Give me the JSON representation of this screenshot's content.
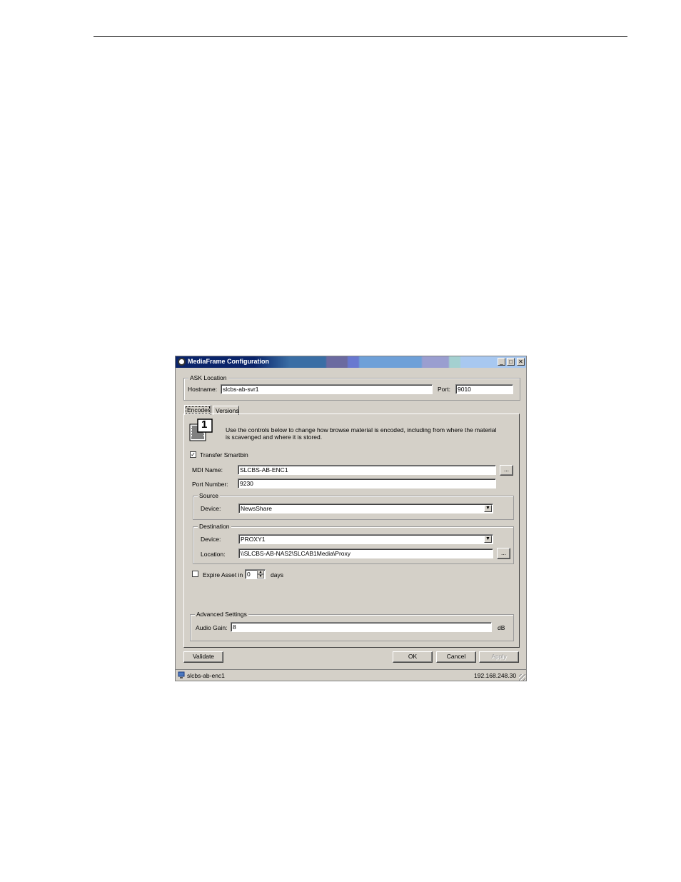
{
  "window": {
    "title": "MediaFrame Configuration",
    "minimize_glyph": "_",
    "maximize_glyph": "□",
    "close_glyph": "✕"
  },
  "ask_location": {
    "legend": "ASK Location",
    "hostname_label": "Hostname:",
    "hostname_value": "slcbs-ab-svr1",
    "port_label": "Port:",
    "port_value": "9010"
  },
  "tabs": [
    {
      "label": "Encoder",
      "selected": true
    },
    {
      "label": "Versions",
      "selected": false
    }
  ],
  "encoder": {
    "icon_digit": "1",
    "description": "Use the controls below to change how browse material is encoded, including from where the material is scavenged and where it is stored.",
    "transfer_smartbin_label": "Transfer Smartbin",
    "transfer_smartbin_checked": true,
    "check_glyph": "✓",
    "mdi_name_label": "MDI Name:",
    "mdi_name_value": "SLCBS-AB-ENC1",
    "browse_glyph": "...",
    "port_number_label": "Port Number:",
    "port_number_value": "9230",
    "source": {
      "legend": "Source",
      "device_label": "Device:",
      "device_value": "NewsShare"
    },
    "destination": {
      "legend": "Destination",
      "device_label": "Device:",
      "device_value": "PROXY1",
      "location_label": "Location:",
      "location_value": "\\\\SLCBS-AB-NAS2\\SLCAB1Media\\Proxy"
    },
    "expire_asset_label": "Expire Asset in",
    "expire_asset_checked": false,
    "expire_days_value": "0",
    "days_label": "days",
    "advanced": {
      "legend": "Advanced Settings",
      "audio_gain_label": "Audio Gain:",
      "audio_gain_value": "8",
      "unit": "dB"
    }
  },
  "buttons": {
    "validate": "Validate",
    "ok": "OK",
    "cancel": "Cancel",
    "apply": "Apply"
  },
  "statusbar": {
    "hostname": "slcbs-ab-enc1",
    "ip": "192.168.248.30"
  }
}
